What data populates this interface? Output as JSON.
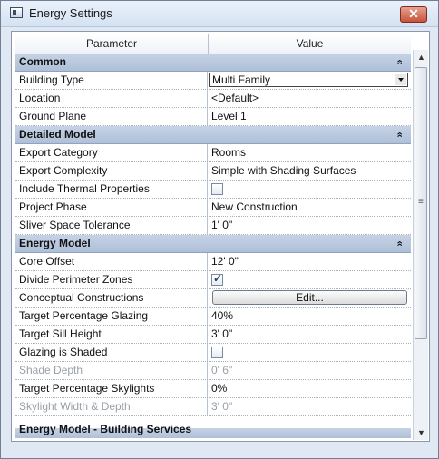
{
  "window": {
    "title": "Energy Settings",
    "close_label": "✕"
  },
  "grid": {
    "headers": {
      "parameter": "Parameter",
      "value": "Value"
    },
    "sections": [
      {
        "label": "Common",
        "rows": [
          {
            "param": "Building Type",
            "value": "Multi Family",
            "type": "dropdown"
          },
          {
            "param": "Location",
            "value": "<Default>"
          },
          {
            "param": "Ground Plane",
            "value": "Level 1"
          }
        ]
      },
      {
        "label": "Detailed Model",
        "rows": [
          {
            "param": "Export Category",
            "value": "Rooms"
          },
          {
            "param": "Export Complexity",
            "value": "Simple with Shading Surfaces"
          },
          {
            "param": "Include Thermal Properties",
            "value": "",
            "type": "checkbox",
            "checked": false
          },
          {
            "param": "Project Phase",
            "value": "New Construction"
          },
          {
            "param": "Sliver Space Tolerance",
            "value": "1'  0\""
          }
        ]
      },
      {
        "label": "Energy Model",
        "rows": [
          {
            "param": "Core Offset",
            "value": "12'  0\""
          },
          {
            "param": "Divide Perimeter Zones",
            "value": "",
            "type": "checkbox",
            "checked": true
          },
          {
            "param": "Conceptual Constructions",
            "value": "Edit...",
            "type": "button"
          },
          {
            "param": "Target Percentage Glazing",
            "value": "40%"
          },
          {
            "param": "Target Sill Height",
            "value": "3'  0\""
          },
          {
            "param": "Glazing is Shaded",
            "value": "",
            "type": "checkbox",
            "checked": false
          },
          {
            "param": "Shade Depth",
            "value": "0'  6\"",
            "disabled": true
          },
          {
            "param": "Target Percentage Skylights",
            "value": "0%"
          },
          {
            "param": "Skylight Width & Depth",
            "value": "3'  0\"",
            "disabled": true
          }
        ]
      }
    ],
    "next_section_partial": "Energy Model - Building Services",
    "collapse_icon": "chevron-up-double"
  }
}
